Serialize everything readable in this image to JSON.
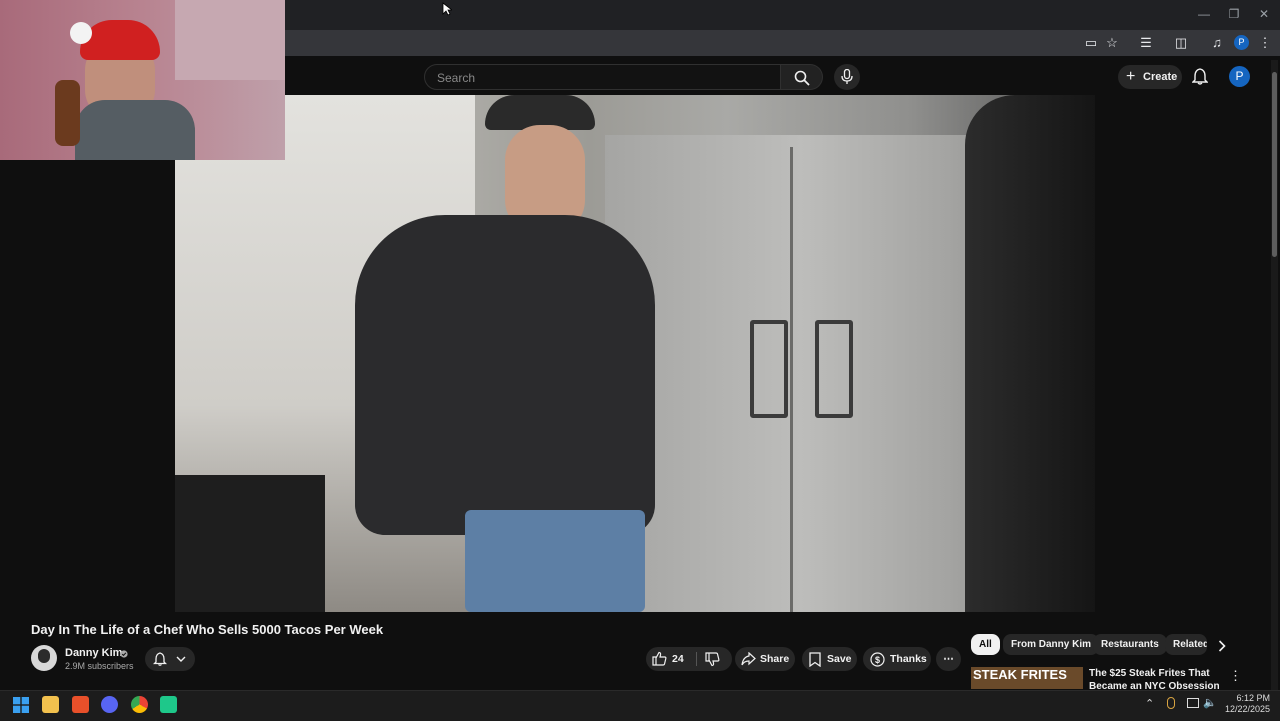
{
  "header": {
    "search_placeholder": "Search",
    "create_label": "Create",
    "avatar_letter": "P"
  },
  "video": {
    "title": "Day In The Life of a Chef Who Sells 5000 Tacos Per Week"
  },
  "channel": {
    "name": "Danny Kim",
    "subscribers": "2.9M subscribers"
  },
  "actions": {
    "like_count": "24",
    "share_label": "Share",
    "save_label": "Save",
    "thanks_label": "Thanks"
  },
  "chips": [
    {
      "label": "All"
    },
    {
      "label": "From Danny Kim"
    },
    {
      "label": "Restaurants"
    },
    {
      "label": "Related"
    }
  ],
  "recommendation": {
    "thumbnail_text": "STEAK FRITES",
    "title_line1": "The $25 Steak Frites That",
    "title_line2": "Became an NYC Obsession —"
  },
  "taskbar": {
    "time": "6:12 PM",
    "date": "12/22/2025"
  },
  "colors": {
    "accent": "#1565c0",
    "background": "#0f0f0f",
    "chip_active": "#f1f1f1"
  }
}
